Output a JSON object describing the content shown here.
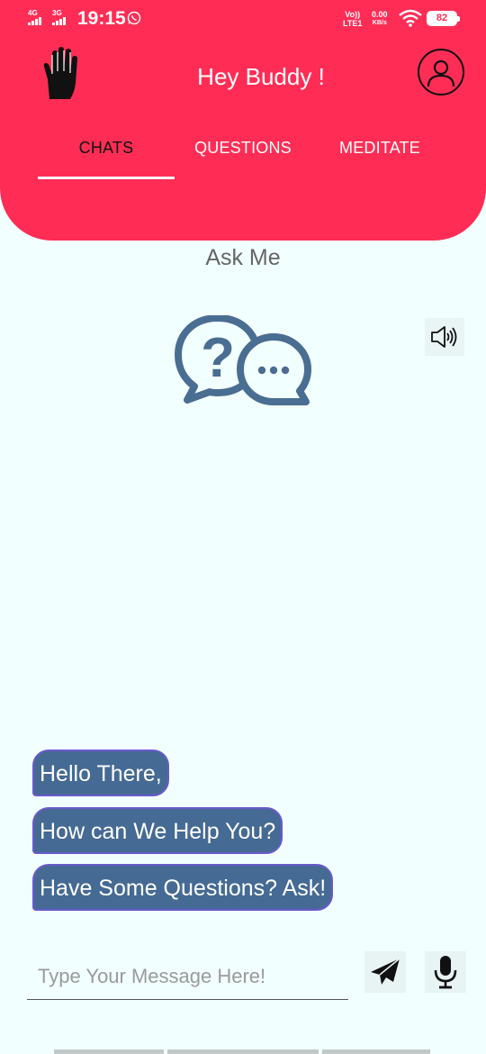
{
  "status_bar": {
    "sim1_network": "4G",
    "sim2_network": "3G",
    "time": "19:15",
    "volte_line1": "Vo))",
    "volte_line2": "LTE1",
    "speed_value": "0.00",
    "speed_unit": "KB/s",
    "battery": "82",
    "icons": [
      "signal-icon",
      "whatsapp-icon",
      "wifi-icon",
      "battery-icon"
    ]
  },
  "header": {
    "title": "Hey Buddy !",
    "left_icon": "hand-icon",
    "right_icon": "profile-icon",
    "background_color": "#ff2d55"
  },
  "tabs": [
    {
      "label": "CHATS",
      "active": true
    },
    {
      "label": "QUESTIONS",
      "active": false
    },
    {
      "label": "MEDITATE",
      "active": false
    }
  ],
  "main": {
    "heading": "Ask Me",
    "center_icon": "question-chat-icon",
    "speaker_icon": "speaker-icon"
  },
  "messages": [
    {
      "text": "Hello There,"
    },
    {
      "text": "How can We Help You?"
    },
    {
      "text": "Have Some Questions? Ask!"
    }
  ],
  "composer": {
    "placeholder": "Type Your Message Here!",
    "value": "",
    "send_icon": "send-icon",
    "mic_icon": "mic-icon"
  },
  "colors": {
    "accent": "#ff2d55",
    "bubble": "#456a93",
    "bubble_border": "#6a5acd",
    "icon_blue": "#4a6d92",
    "background": "#f2ffff"
  }
}
